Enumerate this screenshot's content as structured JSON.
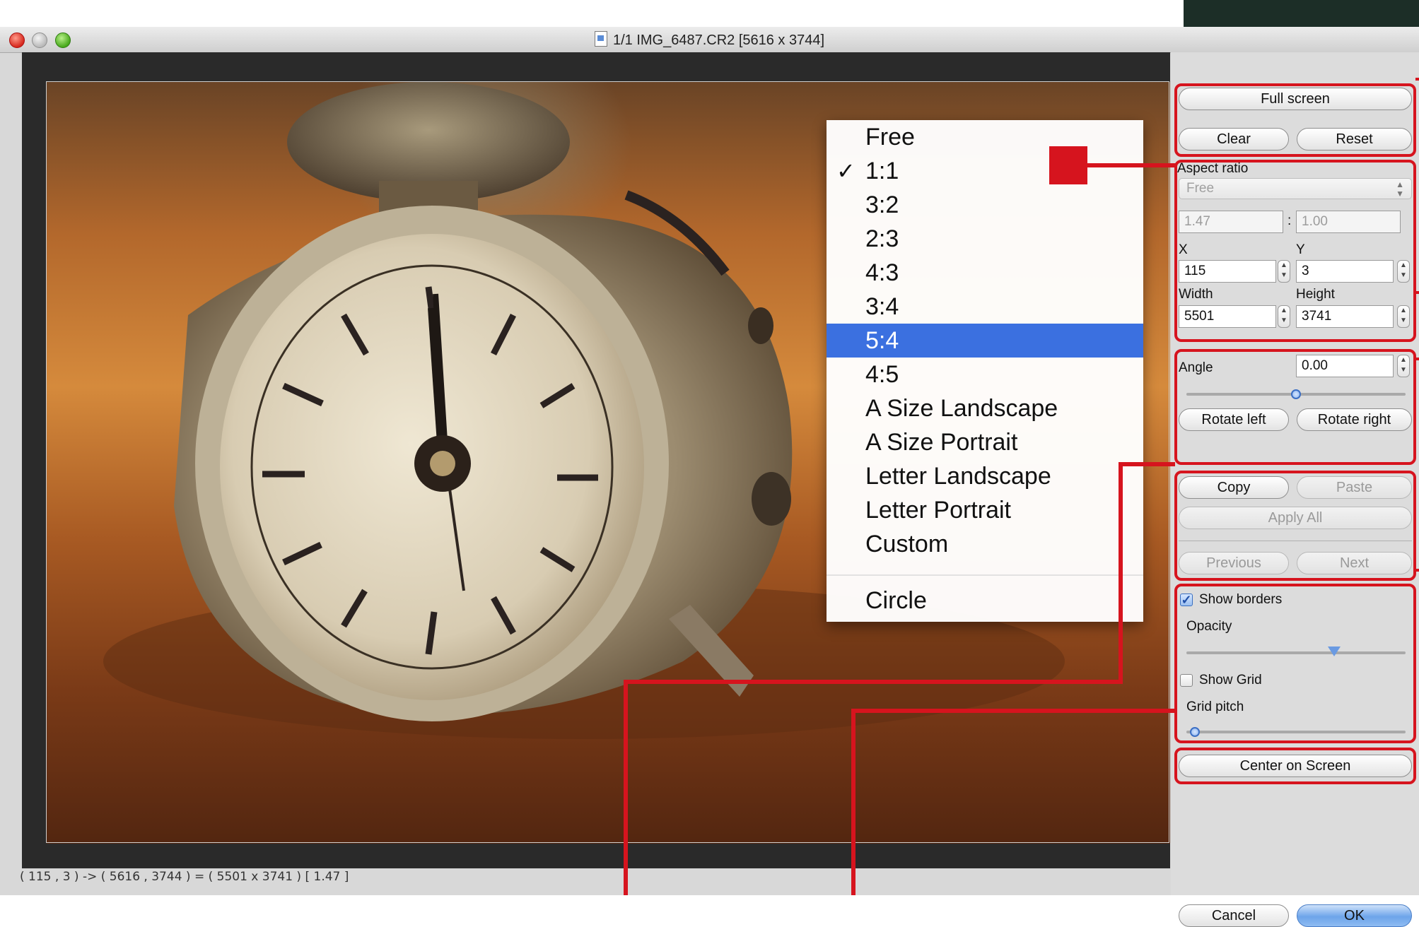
{
  "window": {
    "title": "1/1 IMG_6487.CR2 [5616 x 3744]",
    "status": "( 115 , 3 ) -> ( 5616 , 3744 ) = ( 5501 x 3741 ) [ 1.47 ]"
  },
  "panel": {
    "full_screen": "Full screen",
    "clear": "Clear",
    "reset": "Reset",
    "aspect_ratio_label": "Aspect ratio",
    "aspect_ratio_value": "Free",
    "ratio_w": "1.47",
    "ratio_sep": ":",
    "ratio_h": "1.00",
    "x_label": "X",
    "y_label": "Y",
    "x_value": "115",
    "y_value": "3",
    "width_label": "Width",
    "height_label": "Height",
    "width_value": "5501",
    "height_value": "3741",
    "angle_label": "Angle",
    "angle_value": "0.00",
    "angle_slider": 0.5,
    "rotate_left": "Rotate left",
    "rotate_right": "Rotate right",
    "copy": "Copy",
    "paste": "Paste",
    "apply_all": "Apply All",
    "previous": "Previous",
    "next": "Next",
    "show_borders": "Show borders",
    "show_borders_checked": true,
    "opacity_label": "Opacity",
    "opacity_slider": 0.66,
    "show_grid": "Show Grid",
    "show_grid_checked": false,
    "grid_pitch_label": "Grid pitch",
    "grid_pitch_slider": 0.03,
    "center_on_screen": "Center on Screen",
    "cancel": "Cancel",
    "ok": "OK"
  },
  "menu": {
    "items": [
      "Free",
      "1:1",
      "3:2",
      "2:3",
      "4:3",
      "3:4",
      "5:4",
      "4:5",
      "A Size Landscape",
      "A Size Portrait",
      "Letter Landscape",
      "Letter Portrait",
      "Custom"
    ],
    "checked": "1:1",
    "highlighted": "5:4",
    "extra_item": "Circle",
    "check_mark": "✓"
  },
  "colors": {
    "callout_red": "#d6141e",
    "menu_highlight": "#3b70e0"
  }
}
